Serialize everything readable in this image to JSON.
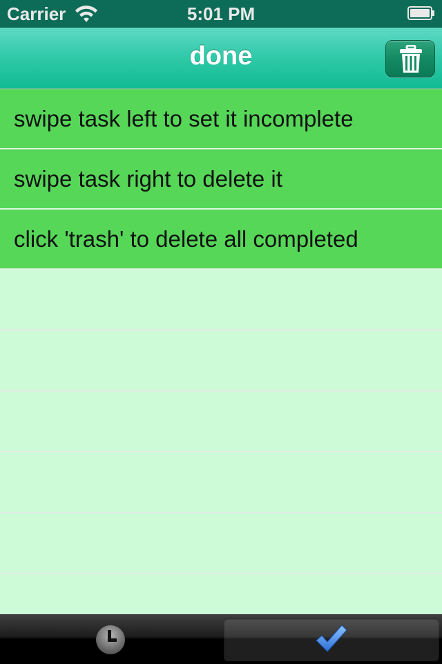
{
  "status_bar": {
    "carrier": "Carrier",
    "time": "5:01 PM"
  },
  "nav": {
    "title": "done",
    "trash_icon": "trash-icon"
  },
  "tasks": [
    {
      "label": "swipe task left to set it incomplete"
    },
    {
      "label": "swipe task right to delete it"
    },
    {
      "label": "click 'trash' to delete all completed"
    }
  ],
  "tab_bar": {
    "tabs": [
      {
        "icon": "clock-icon",
        "selected": false
      },
      {
        "icon": "checkmark-icon",
        "selected": true
      }
    ]
  },
  "colors": {
    "status_bar": "#0c6c57",
    "nav_bar": "#2fc9a8",
    "completed_row": "#56d758",
    "empty_row": "#cdfbd7",
    "tab_bar": "#000000",
    "checkmark": "#4a8fe6"
  }
}
